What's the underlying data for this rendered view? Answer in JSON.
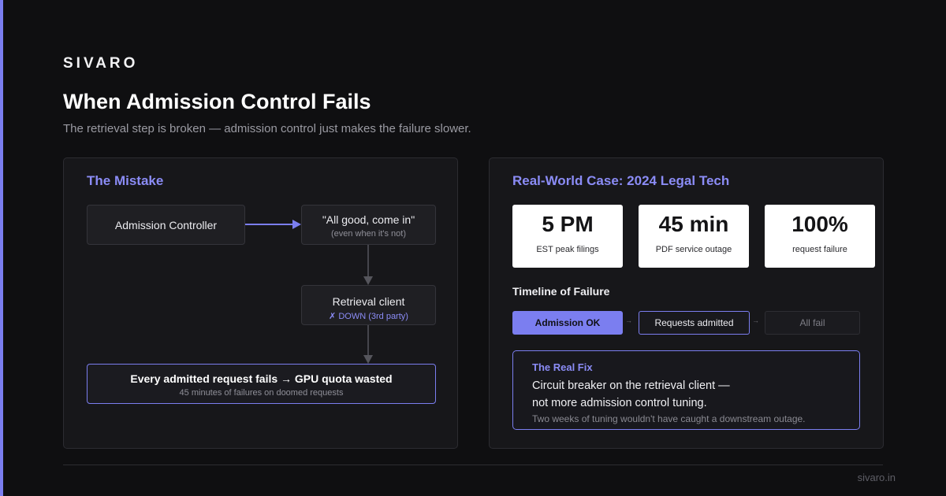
{
  "brand": "SIVARO",
  "title": "When Admission Control Fails",
  "subtitle": "The retrieval step is broken — admission control just makes the failure slower.",
  "mistake": {
    "title": "The Mistake",
    "admission_controller": "Admission Controller",
    "all_good": "\"All good, come in\"",
    "all_good_sub": "(even when it's not)",
    "retrieval_client": "Retrieval client",
    "retrieval_status": "✗ DOWN (3rd party)",
    "result": "Every admitted request fails → GPU quota wasted",
    "result_sub": "45 minutes of failures on doomed requests"
  },
  "case": {
    "title": "Real-World Case: 2024 Legal Tech",
    "stats": [
      {
        "value": "5 PM",
        "label": "EST peak filings"
      },
      {
        "value": "45 min",
        "label": "PDF service outage"
      },
      {
        "value": "100%",
        "label": "request failure"
      }
    ],
    "timeline_title": "Timeline of Failure",
    "timeline": [
      "Admission OK",
      "Requests admitted",
      "All fail"
    ],
    "fix": {
      "label": "The Real Fix",
      "line1": "Circuit breaker on the retrieval client —",
      "line2": "not more admission control tuning.",
      "note": "Two weeks of tuning wouldn't have caught a downstream outage."
    }
  },
  "footer": {
    "url": "sivaro.in"
  },
  "colors": {
    "accent": "#7b7ef0",
    "background": "#0f0f11",
    "panel": "#17171a"
  }
}
